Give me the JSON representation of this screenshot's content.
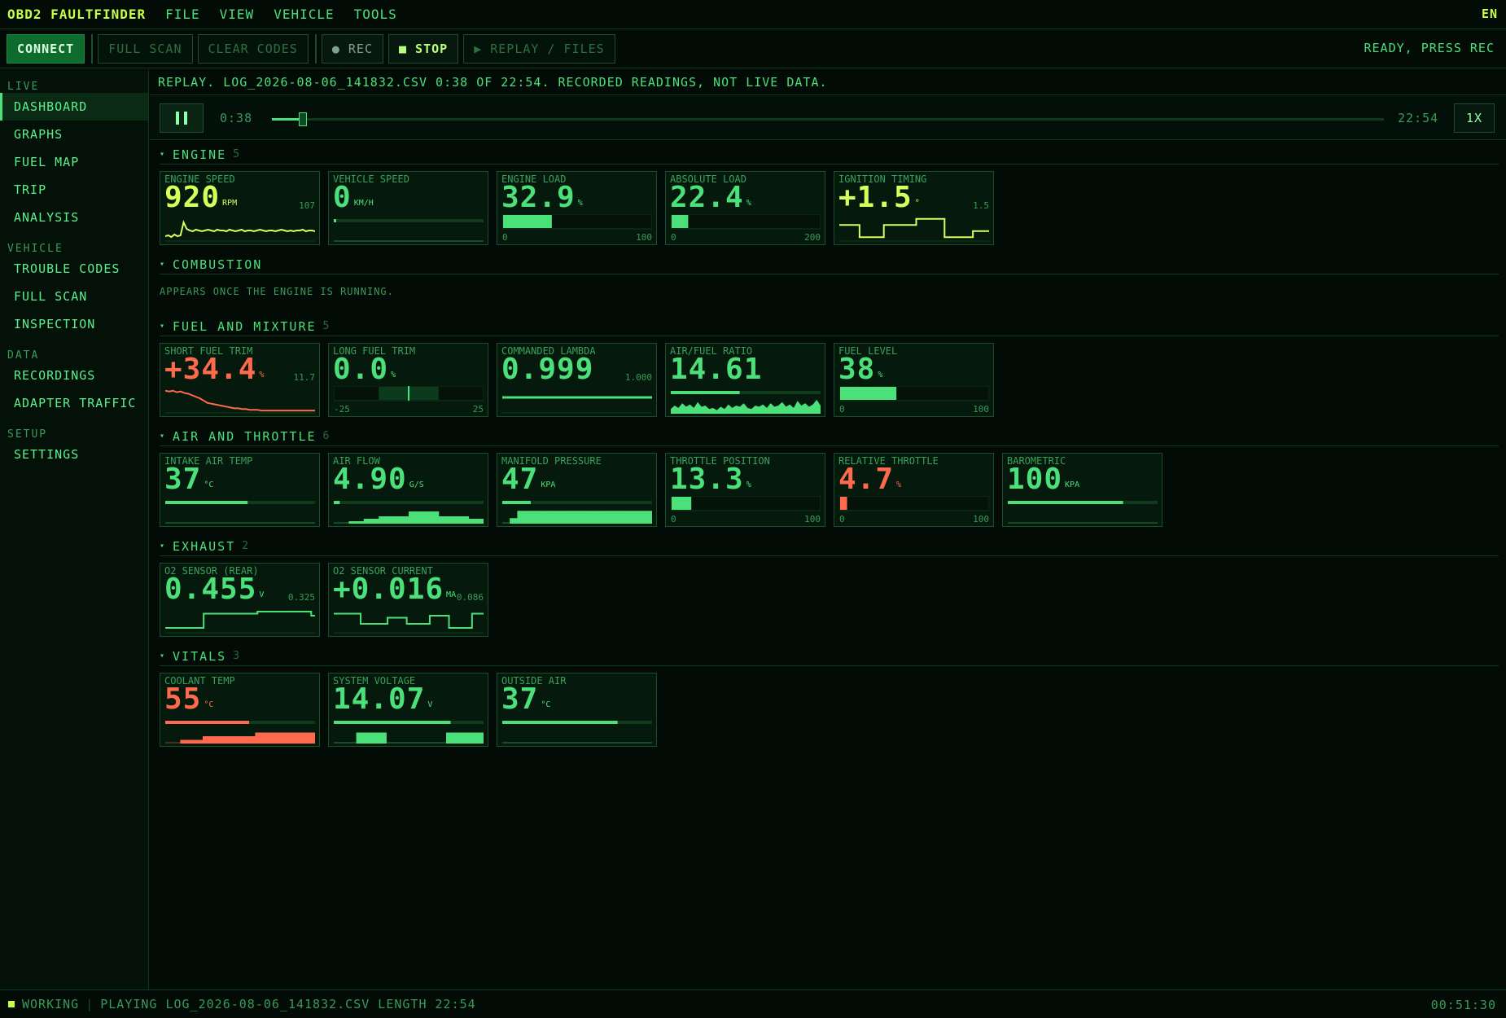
{
  "app": {
    "title": "OBD2 FAULTFINDER",
    "menus": [
      "FILE",
      "VIEW",
      "VEHICLE",
      "TOOLS"
    ],
    "language": "EN"
  },
  "toolbar": {
    "connect": "CONNECT",
    "full_scan": "FULL SCAN",
    "clear_codes": "CLEAR CODES",
    "rec": "● REC",
    "stop": "■ STOP",
    "replay": "▶ REPLAY / FILES",
    "status": "READY, PRESS REC"
  },
  "sidebar": {
    "sections": [
      {
        "title": "LIVE",
        "items": [
          "DASHBOARD",
          "GRAPHS",
          "FUEL MAP",
          "TRIP",
          "ANALYSIS"
        ]
      },
      {
        "title": "VEHICLE",
        "items": [
          "TROUBLE CODES",
          "FULL SCAN",
          "INSPECTION"
        ]
      },
      {
        "title": "DATA",
        "items": [
          "RECORDINGS",
          "ADAPTER TRAFFIC"
        ]
      },
      {
        "title": "SETUP",
        "items": [
          "SETTINGS"
        ]
      }
    ],
    "active": "DASHBOARD"
  },
  "replay": {
    "banner": "REPLAY. LOG_2026-08-06_141832.CSV 0:38 OF 22:54. RECORDED READINGS, NOT LIVE DATA.",
    "current": "0:38",
    "total": "22:54",
    "speed": "1X",
    "progress": 0.028
  },
  "sections": [
    {
      "title": "ENGINE",
      "count": "5",
      "cards": [
        {
          "label": "ENGINE SPEED",
          "value": "920",
          "unit": "RPM",
          "color": "yellow",
          "corner": "107",
          "viz": "spark",
          "series": [
            5,
            6,
            4,
            7,
            5,
            6,
            22,
            14,
            12,
            11,
            13,
            12,
            11,
            12,
            13,
            12,
            11,
            13,
            12,
            12,
            11,
            13,
            12,
            11,
            12,
            13,
            11,
            12,
            12,
            11,
            12,
            13,
            12,
            11,
            12,
            12,
            11,
            12,
            13,
            12,
            11,
            12,
            11,
            12,
            12,
            13,
            11,
            12,
            12,
            11
          ],
          "range": [
            0,
            30
          ]
        },
        {
          "label": "VEHICLE SPEED",
          "value": "0",
          "unit": "KM/H",
          "color": "green",
          "viz": "hbar",
          "level": 0.0
        },
        {
          "label": "ENGINE LOAD",
          "value": "32.9",
          "unit": "%",
          "color": "green",
          "viz": "bar",
          "level": 0.329,
          "scale_min": "0",
          "scale_max": "100"
        },
        {
          "label": "ABSOLUTE LOAD",
          "value": "22.4",
          "unit": "%",
          "color": "green",
          "viz": "bar",
          "level": 0.112,
          "scale_min": "0",
          "scale_max": "200"
        },
        {
          "label": "IGNITION TIMING",
          "value": "+1.5",
          "unit": "°",
          "color": "yellow",
          "corner": "1.5",
          "viz": "step",
          "series": [
            10,
            10,
            10,
            10,
            10,
            2,
            2,
            2,
            2,
            2,
            2,
            10,
            10,
            10,
            10,
            10,
            10,
            10,
            10,
            14,
            14,
            14,
            14,
            14,
            14,
            14,
            2,
            2,
            2,
            2,
            2,
            2,
            2,
            6,
            6,
            6,
            6,
            6
          ],
          "range": [
            0,
            16
          ]
        }
      ]
    },
    {
      "title": "COMBUSTION",
      "count": "",
      "note": "APPEARS ONCE THE ENGINE IS RUNNING.",
      "cards": []
    },
    {
      "title": "FUEL AND MIXTURE",
      "count": "5",
      "cards": [
        {
          "label": "SHORT FUEL TRIM",
          "value": "+34.4",
          "unit": "%",
          "color": "red",
          "corner": "11.7",
          "viz": "spark",
          "series": [
            28,
            27,
            28,
            26,
            27,
            25,
            24,
            22,
            20,
            18,
            15,
            12,
            11,
            10,
            9,
            8,
            7,
            6,
            5,
            5,
            4,
            4,
            3,
            3,
            3,
            2,
            2,
            2,
            2,
            2,
            2,
            2,
            2,
            2,
            2,
            2,
            2,
            2,
            2,
            2
          ],
          "range": [
            0,
            32
          ]
        },
        {
          "label": "LONG FUEL TRIM",
          "value": "0.0",
          "unit": "%",
          "color": "green",
          "viz": "center",
          "level": 0.5,
          "scale_min": "-25",
          "scale_max": "25"
        },
        {
          "label": "COMMANDED LAMBDA",
          "value": "0.999",
          "unit": "",
          "color": "green",
          "corner": "1.000",
          "viz": "flat"
        },
        {
          "label": "AIR/FUEL RATIO",
          "value": "14.61",
          "unit": "",
          "color": "green",
          "viz": "hbar-area",
          "level": 0.46,
          "series": [
            4,
            7,
            5,
            9,
            6,
            8,
            5,
            10,
            6,
            7,
            4,
            5,
            3,
            6,
            4,
            8,
            5,
            7,
            6,
            9,
            5,
            4,
            7,
            6,
            8,
            5,
            9,
            6,
            7,
            10,
            6,
            8,
            5,
            11,
            7,
            9,
            6,
            8,
            12,
            7
          ],
          "range": [
            0,
            14
          ]
        },
        {
          "label": "FUEL LEVEL",
          "value": "38",
          "unit": "%",
          "color": "green",
          "viz": "bar",
          "level": 0.38,
          "scale_min": "0",
          "scale_max": "100"
        }
      ]
    },
    {
      "title": "AIR AND THROTTLE",
      "count": "6",
      "cards": [
        {
          "label": "INTAKE AIR TEMP",
          "value": "37",
          "unit": "°C",
          "color": "green",
          "viz": "hbar",
          "level": 0.55
        },
        {
          "label": "AIR FLOW",
          "value": "4.90",
          "unit": "G/S",
          "color": "green",
          "viz": "hbar-blocks",
          "level": 0.04,
          "series": [
            0,
            0,
            1,
            1,
            2,
            2,
            3,
            3,
            3,
            3,
            5,
            5,
            5,
            5,
            3,
            3,
            3,
            3,
            2,
            2
          ],
          "range": [
            0,
            6
          ]
        },
        {
          "label": "MANIFOLD PRESSURE",
          "value": "47",
          "unit": "KPA",
          "color": "green",
          "viz": "hbar-blocks",
          "level": 0.19,
          "series": [
            0,
            3,
            7,
            7,
            7,
            7,
            7,
            7,
            7,
            7,
            7,
            7,
            7,
            7,
            7,
            7,
            7,
            7,
            7,
            7
          ],
          "range": [
            0,
            8
          ]
        },
        {
          "label": "THROTTLE POSITION",
          "value": "13.3",
          "unit": "%",
          "color": "green",
          "viz": "bar",
          "level": 0.133,
          "scale_min": "0",
          "scale_max": "100"
        },
        {
          "label": "RELATIVE THROTTLE",
          "value": "4.7",
          "unit": "%",
          "color": "red",
          "viz": "bar",
          "level": 0.047,
          "scale_min": "0",
          "scale_max": "100"
        },
        {
          "label": "BAROMETRIC",
          "value": "100",
          "unit": "KPA",
          "color": "green",
          "viz": "hbar",
          "level": 0.77
        }
      ]
    },
    {
      "title": "EXHAUST",
      "count": "2",
      "cards": [
        {
          "label": "O2 SENSOR (REAR)",
          "value": "0.455",
          "unit": "V",
          "color": "green",
          "corner": "0.325",
          "viz": "step",
          "series": [
            2,
            2,
            2,
            2,
            2,
            2,
            2,
            2,
            2,
            2,
            9,
            9,
            9,
            9,
            9,
            9,
            9,
            9,
            9,
            9,
            9,
            9,
            9,
            9,
            10,
            10,
            10,
            10,
            10,
            10,
            10,
            10,
            10,
            10,
            10,
            10,
            10,
            10,
            8,
            8
          ],
          "range": [
            0,
            12
          ]
        },
        {
          "label": "O2 SENSOR CURRENT",
          "value": "+0.016",
          "unit": "MA",
          "color": "green",
          "corner": "0.086",
          "viz": "step",
          "series": [
            9,
            9,
            9,
            9,
            9,
            9,
            9,
            4,
            4,
            4,
            4,
            4,
            4,
            4,
            7,
            7,
            7,
            7,
            7,
            4,
            4,
            4,
            4,
            4,
            4,
            8,
            8,
            8,
            8,
            8,
            2,
            2,
            2,
            2,
            2,
            2,
            9,
            9,
            9,
            9
          ],
          "range": [
            0,
            12
          ]
        }
      ]
    },
    {
      "title": "VITALS",
      "count": "3",
      "cards": [
        {
          "label": "COOLANT TEMP",
          "value": "55",
          "unit": "°C",
          "color": "red",
          "viz": "hbar-blocks",
          "level": 0.56,
          "series": [
            0,
            0,
            1,
            1,
            1,
            2,
            2,
            2,
            2,
            2,
            2,
            2,
            3,
            3,
            3,
            3,
            3,
            3,
            3,
            3
          ],
          "range": [
            0,
            4
          ]
        },
        {
          "label": "SYSTEM VOLTAGE",
          "value": "14.07",
          "unit": "V",
          "color": "green",
          "viz": "hbar-blocks",
          "level": 0.78,
          "series": [
            0,
            0,
            0,
            3,
            3,
            3,
            3,
            0,
            0,
            0,
            0,
            0,
            0,
            0,
            0,
            3,
            3,
            3,
            3,
            3
          ],
          "range": [
            0,
            4
          ]
        },
        {
          "label": "OUTSIDE AIR",
          "value": "37",
          "unit": "°C",
          "color": "green",
          "viz": "hbar",
          "level": 0.77
        }
      ]
    }
  ],
  "statusbar": {
    "state": "WORKING",
    "message": "PLAYING LOG_2026-08-06_141832.CSV LENGTH 22:54",
    "clock": "00:51:30"
  },
  "colors": {
    "green": "#4be07a",
    "yellow": "#d6ff5a",
    "red": "#ff6a4d",
    "track": "#0f3a1c"
  }
}
